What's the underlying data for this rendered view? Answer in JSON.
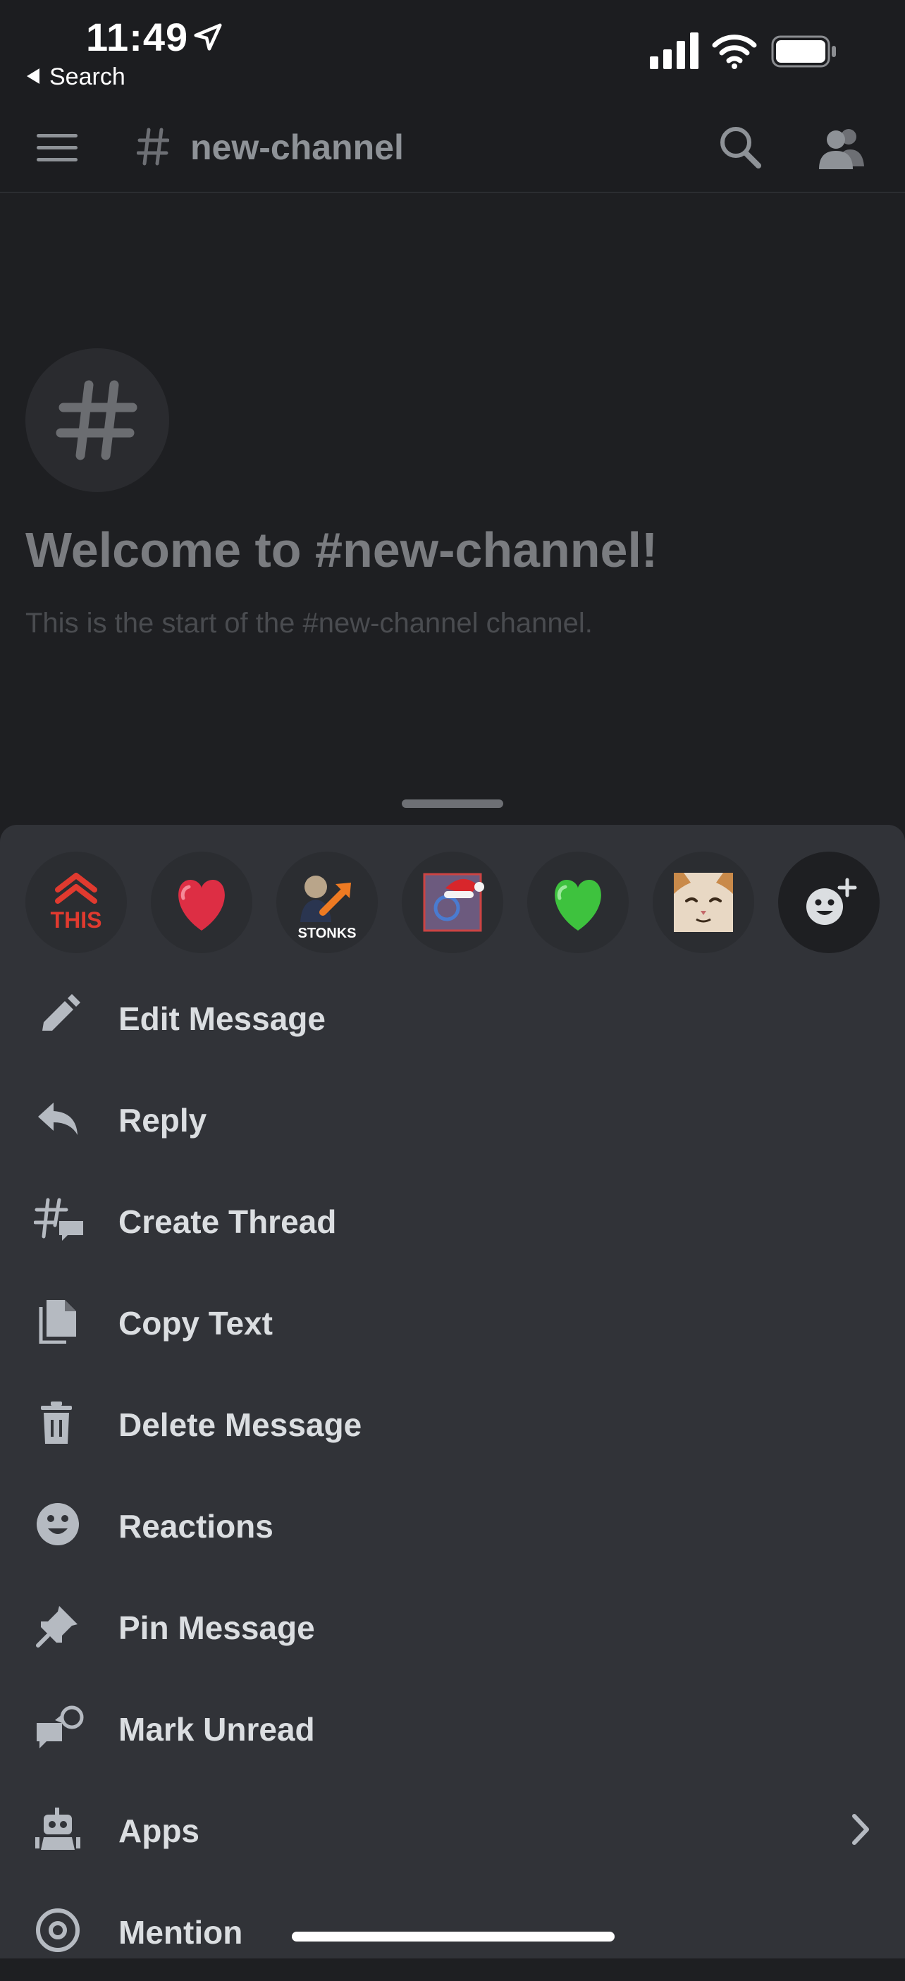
{
  "status_bar": {
    "time": "11:49",
    "back_label": "Search"
  },
  "header": {
    "channel_name": "new-channel"
  },
  "welcome": {
    "title": "Welcome to #new-channel!",
    "subtitle": "This is the start of the #new-channel channel."
  },
  "reactions": [
    {
      "name": "this-emoji",
      "label": "THIS"
    },
    {
      "name": "red-heart-emoji"
    },
    {
      "name": "stonks-emoji",
      "label": "STONKS"
    },
    {
      "name": "santa-hat-emoji"
    },
    {
      "name": "green-heart-emoji"
    },
    {
      "name": "cat-emoji"
    },
    {
      "name": "add-reaction-icon"
    }
  ],
  "menu": {
    "items": [
      {
        "label": "Edit Message",
        "icon": "pencil-icon"
      },
      {
        "label": "Reply",
        "icon": "reply-icon"
      },
      {
        "label": "Create Thread",
        "icon": "thread-icon"
      },
      {
        "label": "Copy Text",
        "icon": "copy-icon"
      },
      {
        "label": "Delete Message",
        "icon": "trash-icon"
      },
      {
        "label": "Reactions",
        "icon": "smiley-icon"
      },
      {
        "label": "Pin Message",
        "icon": "pin-icon"
      },
      {
        "label": "Mark Unread",
        "icon": "mark-unread-icon"
      },
      {
        "label": "Apps",
        "icon": "robot-icon"
      },
      {
        "label": "Mention",
        "icon": "at-icon"
      }
    ]
  },
  "colors": {
    "accent_red": "#e03a2f",
    "heart_red": "#dd2e44",
    "heart_green": "#3ec23e",
    "sheet_bg": "#313338"
  }
}
